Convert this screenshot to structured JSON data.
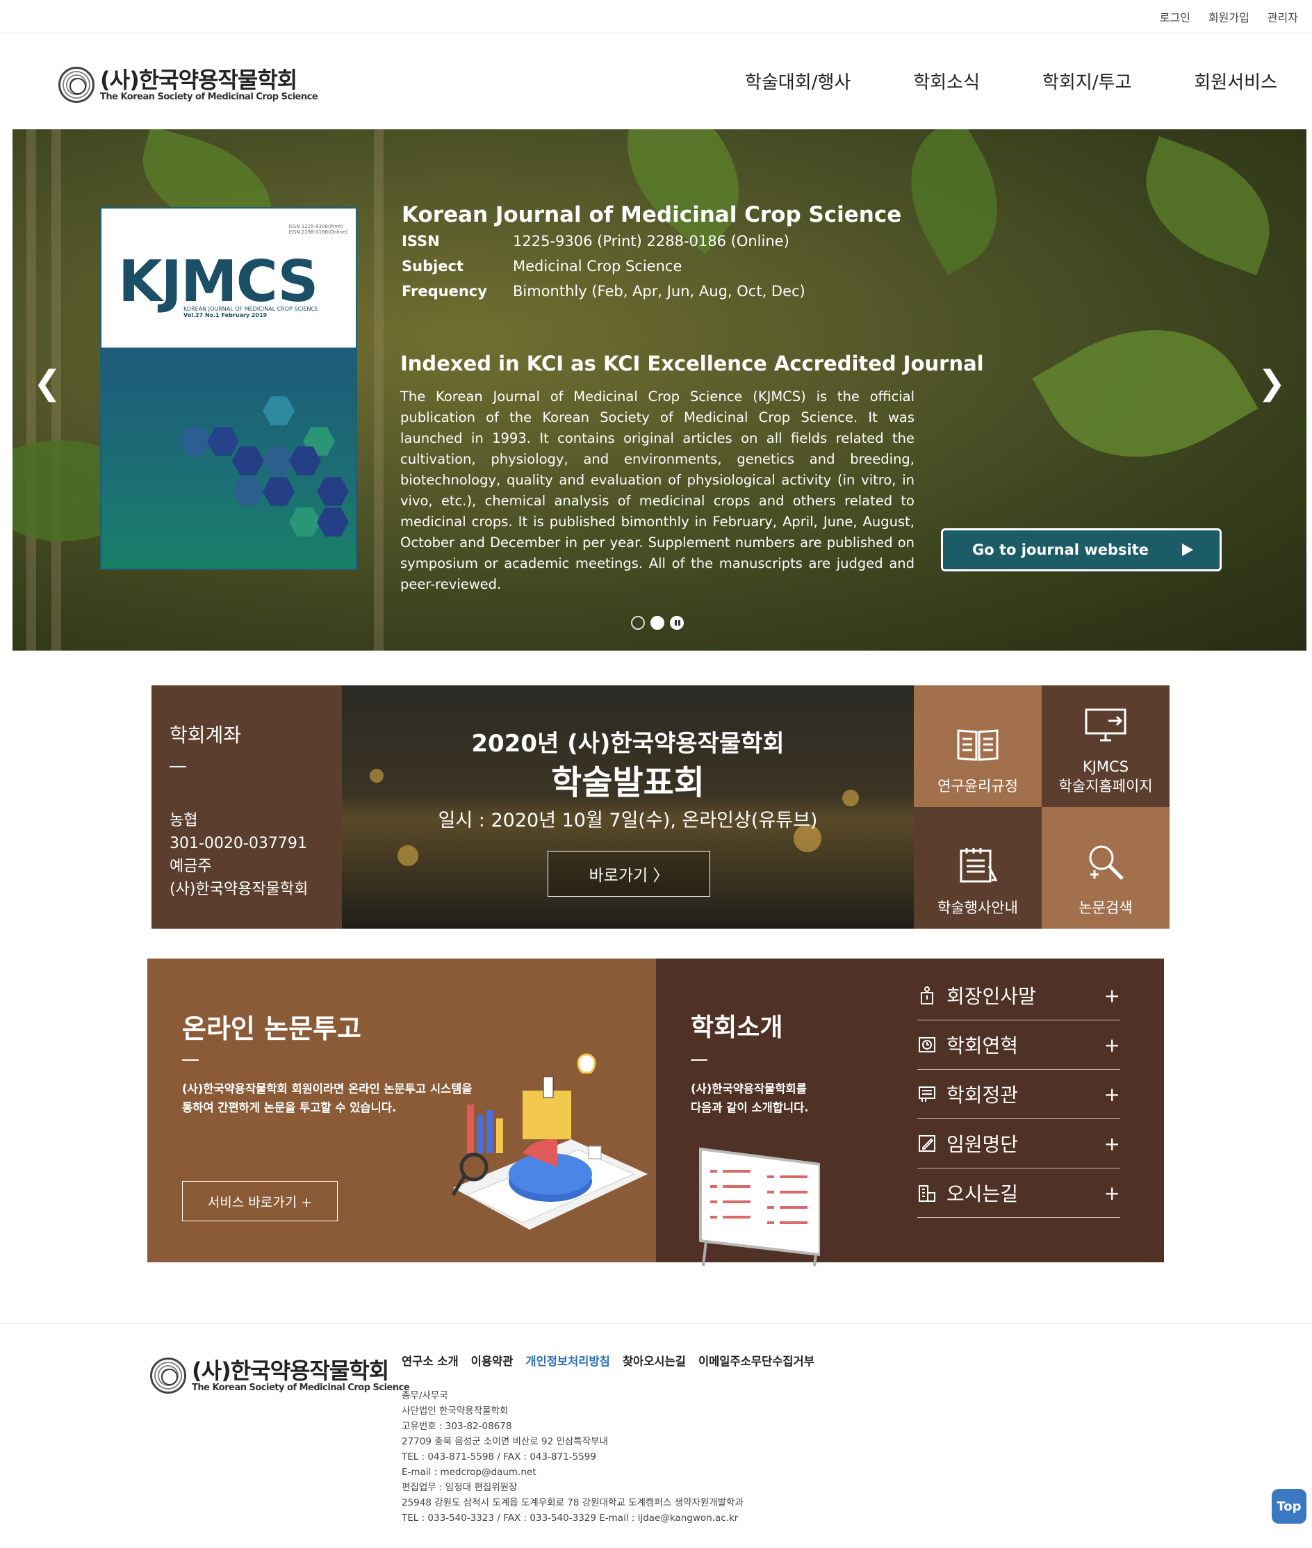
{
  "utility": {
    "login": "로그인",
    "join": "회원가입",
    "admin": "관리자"
  },
  "logo": {
    "kr": "(사)한국약용작물학회",
    "en": "The Korean Society of Medicinal Crop Science"
  },
  "nav": {
    "items": [
      "학술대회/행사",
      "학회소식",
      "학회지/투고",
      "회원서비스"
    ]
  },
  "hero": {
    "cover": {
      "title": "KJMCS",
      "sub": "KOREAN JOURNAL OF MEDICINAL CROP SCIENCE",
      "vol": "Vol.27 No.1 February 2019",
      "issn1": "ISSN 1225-9306(Print)",
      "issn2": "ISSN 2288-0186(Online)"
    },
    "title": "Korean Journal of Medicinal Crop Science",
    "meta": [
      {
        "k": "ISSN",
        "v": "1225-9306 (Print) 2288-0186 (Online)"
      },
      {
        "k": "Subject",
        "v": "Medicinal Crop Science"
      },
      {
        "k": "Frequency",
        "v": "Bimonthly (Feb, Apr, Jun, Aug, Oct, Dec)"
      }
    ],
    "headline": "Indexed in KCI as KCI Excellence Accredited Journal",
    "body": "The Korean Journal of Medicinal Crop Science (KJMCS) is the official publication of the Korean Society of Medicinal Crop Science. It was launched in 1993. It contains original articles on all fields related the cultivation, physiology, and environments, genetics and breeding, biotechnology, quality and evaluation of physiological activity (in vitro, in vivo, etc.), chemical analysis of medicinal crops and others related to medicinal crops. It is published bimonthly in February, April, June, August, October and December in per year. Supplement numbers are published on symposium or academic meetings. All of the manuscripts are judged and peer-reviewed.",
    "button": "Go to journal website",
    "prev": "❮",
    "next": "❯"
  },
  "account": {
    "title": "학회계좌",
    "bank": "농협",
    "number": "301-0020-037791",
    "holder_label": "예금주",
    "holder": "(사)한국약용작물학회"
  },
  "event": {
    "line1": "2020년 (사)한국약용작물학회",
    "line2": "학술발표회",
    "line3": "일시 : 2020년 10월 7일(수), 온라인상(유튜브)",
    "button": "바로가기 〉"
  },
  "quick": [
    {
      "label": "연구윤리규정",
      "icon": "book-icon"
    },
    {
      "label1": "KJMCS",
      "label2": "학술지홈페이지",
      "icon": "monitor-icon"
    },
    {
      "label": "학술행사안내",
      "icon": "calendar-icon"
    },
    {
      "label": "논문검색",
      "icon": "search-icon"
    }
  ],
  "submit": {
    "title": "온라인 논문투고",
    "desc1": "(사)한국약용작물학회 회원이라면 온라인 논문투고 시스템을",
    "desc2": "통하여 간편하게 논문을 투고할 수 있습니다.",
    "button": "서비스 바로가기 +"
  },
  "intro": {
    "title": "학회소개",
    "desc1": "(사)한국약용작물학회를",
    "desc2": "다음과 같이 소개합니다.",
    "menu": [
      {
        "label": "회장인사말",
        "icon": "person-icon"
      },
      {
        "label": "학회연혁",
        "icon": "history-icon"
      },
      {
        "label": "학회정관",
        "icon": "document-icon"
      },
      {
        "label": "임원명단",
        "icon": "edit-icon"
      },
      {
        "label": "오시는길",
        "icon": "building-icon"
      }
    ],
    "plus": "+"
  },
  "footer": {
    "links": [
      "연구소 소개",
      "이용약관",
      "개인정보처리방침",
      "찾아오시는길",
      "이메일주소무단수집거부"
    ],
    "info": [
      "총무/사무국",
      "사단법인 한국약용작물학회",
      "고유번호 : 303-82-08678",
      "27709 충북 음성군 소이면 비산로 92 인삼특작부내",
      "TEL : 043-871-5598 / FAX : 043-871-5599",
      "E-mail : medcrop@daum.net",
      "편집업무 : 임정대 편집위원장",
      "25948 강원도 삼척시 도계읍 도계우회로 78 강원대학교 도계캠퍼스 생약자원개발학과",
      "TEL : 033-540-3323 / FAX : 033-540-3329 E-mail : ijdae@kangwon.ac.kr"
    ]
  },
  "top_button": "Top"
}
